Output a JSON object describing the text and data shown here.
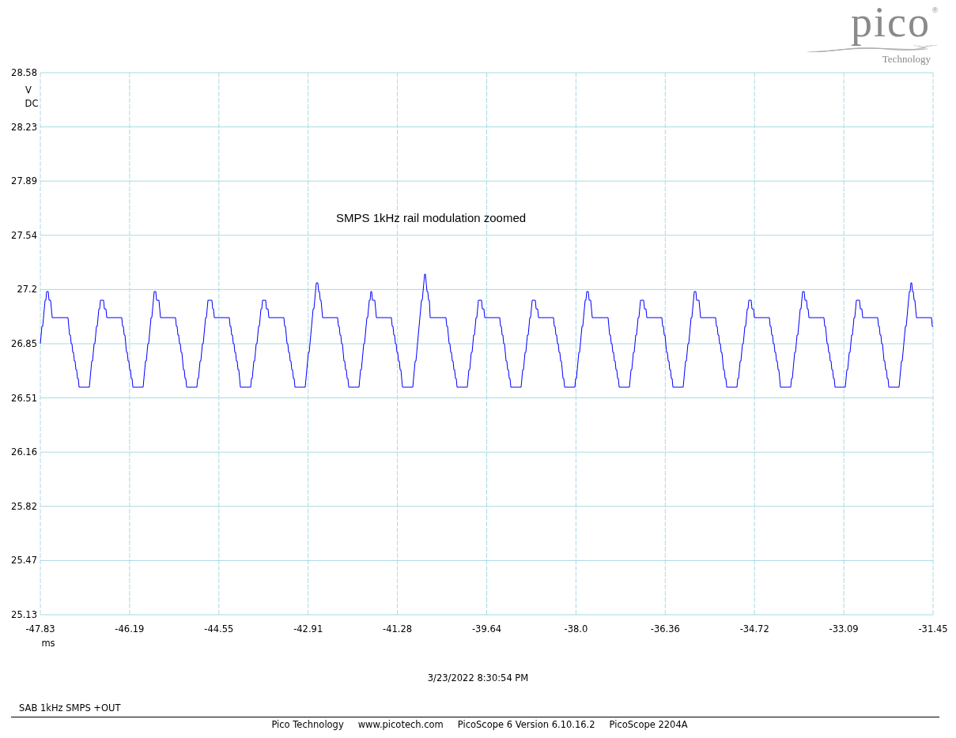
{
  "logo": {
    "wordmark": "pico",
    "registered": "®",
    "tagline": "Technology"
  },
  "chart": {
    "title": "SMPS 1kHz rail modulation zoomed",
    "y_axis": {
      "ticks": [
        "28.58",
        "28.23",
        "27.89",
        "27.54",
        "27.2",
        "26.85",
        "26.51",
        "26.16",
        "25.82",
        "25.47",
        "25.13"
      ],
      "unit": "V",
      "coupling": "DC"
    },
    "x_axis": {
      "ticks": [
        "-47.83",
        "-46.19",
        "-44.55",
        "-42.91",
        "-41.28",
        "-39.64",
        "-38.0",
        "-36.36",
        "-34.72",
        "-33.09",
        "-31.45"
      ],
      "unit": "ms"
    }
  },
  "timestamp": "3/23/2022 8:30:54 PM",
  "channel_label": "SAB 1kHz SMPS +OUT",
  "footer": [
    "Pico Technology",
    "www.picotech.com",
    "PicoScope 6 Version 6.10.16.2",
    "PicoScope 2204A"
  ]
}
